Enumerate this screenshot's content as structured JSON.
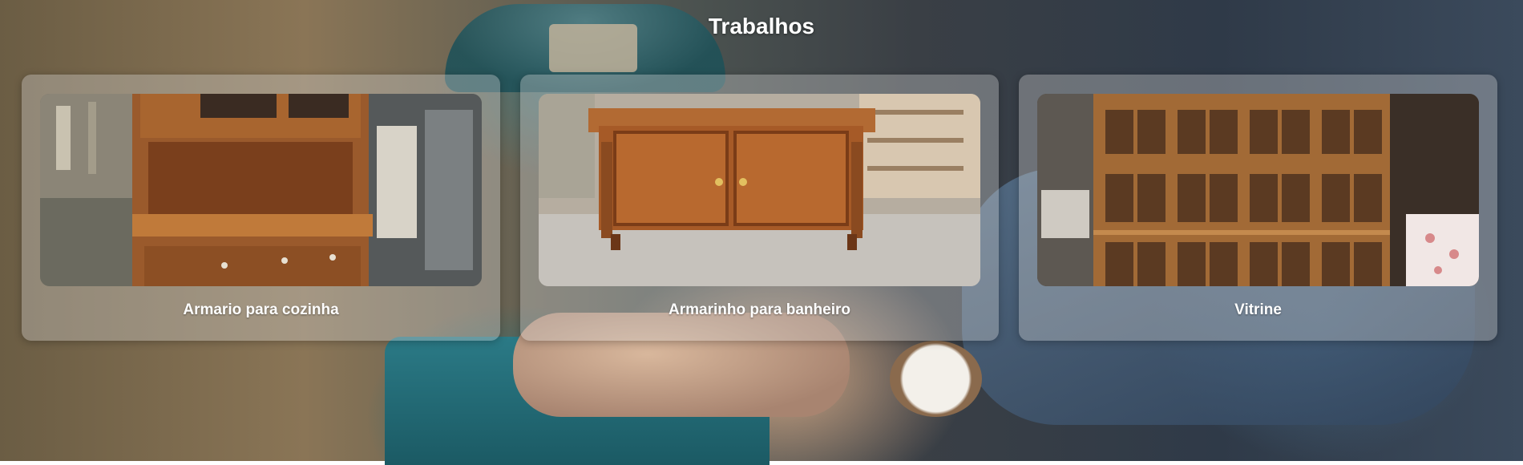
{
  "section": {
    "title": "Trabalhos"
  },
  "works": [
    {
      "caption": "Armario para cozinha",
      "image": "kitchen-cabinet-photo"
    },
    {
      "caption": "Armarinho para banheiro",
      "image": "bathroom-cabinet-photo"
    },
    {
      "caption": "Vitrine",
      "image": "display-cabinet-photo"
    }
  ],
  "colors": {
    "title_text": "#ffffff",
    "card_background": "rgba(215,215,215,0.35)",
    "wood": "#9a5a2c"
  }
}
